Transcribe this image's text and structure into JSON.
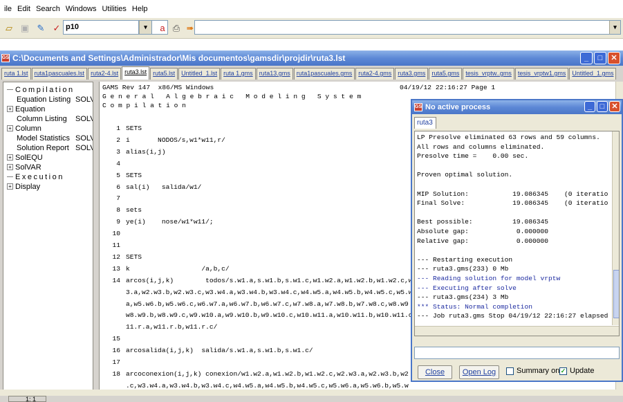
{
  "menubar": {
    "items": [
      "ile",
      "Edit",
      "Search",
      "Windows",
      "Utilities",
      "Help"
    ]
  },
  "toolbar": {
    "model_combo": "p10"
  },
  "window": {
    "title": "C:\\Documents and Settings\\Administrador\\Mis documentos\\gamsdir\\projdir\\ruta3.lst",
    "tabs": [
      "ruta 1.lst",
      "ruta1pascuales.lst",
      "ruta2-4.lst",
      "ruta3.lst",
      "ruta5.lst",
      "Untitled_1.lst",
      "ruta 1.gms",
      "ruta13.gms",
      "ruta1pascuales.gms",
      "ruta2-4.gms",
      "ruta3.gms",
      "ruta5.gms",
      "tesis_vrptw..gms",
      "tesis_vrptw1.gms",
      "Untitled_1.gms"
    ],
    "active_tab": 3
  },
  "tree": [
    {
      "label": "Compilation",
      "type": "line",
      "spaced": true
    },
    {
      "label": "Equation Listing",
      "col2": "SOLV",
      "type": "sub"
    },
    {
      "label": "Equation",
      "type": "expand"
    },
    {
      "label": "Column Listing",
      "col2": "SOLV",
      "type": "sub"
    },
    {
      "label": "Column",
      "type": "expand"
    },
    {
      "label": "Model Statistics",
      "col2": "SOLV",
      "type": "sub"
    },
    {
      "label": "Solution Report",
      "col2": "SOLV",
      "type": "sub"
    },
    {
      "label": "SolEQU",
      "type": "expand"
    },
    {
      "label": "SolVAR",
      "type": "expand"
    },
    {
      "label": "Execution",
      "type": "line",
      "spaced": true
    },
    {
      "label": "Display",
      "type": "expand"
    }
  ],
  "listing": {
    "header1": "GAMS Rev 147  x86/MS Windows",
    "header_date": "04/19/12 22:16:27 Page 1",
    "header2": "G e n e r a l   A l g e b r a i c   M o d e l i n g   S y s t e m",
    "header3": "C o m p i l a t i o n",
    "lines": [
      {
        "n": "1",
        "t": "SETS"
      },
      {
        "n": "2",
        "t": "i       NODOS/s,w1*w11,r/"
      },
      {
        "n": "3",
        "t": "alias(i,j)"
      },
      {
        "n": "4",
        "t": ""
      },
      {
        "n": "5",
        "t": "SETS"
      },
      {
        "n": "6",
        "t": "sal(i)   salida/w1/"
      },
      {
        "n": "7",
        "t": ""
      },
      {
        "n": "8",
        "t": "sets"
      },
      {
        "n": "9",
        "t": "ye(i)    nose/w1*w11/;"
      },
      {
        "n": "10",
        "t": ""
      },
      {
        "n": "11",
        "t": ""
      },
      {
        "n": "12",
        "t": "SETS"
      },
      {
        "n": "13",
        "t": "k                  /a,b,c/"
      },
      {
        "n": "14",
        "t": "arcos(i,j,k)        todos/s.w1.a,s.w1.b,s.w1.c,w1.w2.a,w1.w2.b,w1.w2.c,w2"
      },
      {
        "n": "",
        "t": "3.a,w2.w3.b,w2.w3.c,w3.w4.a,w3.w4.b,w3.w4.c,w4.w5.a,w4.w5.b,w4.w5.c,w5.w"
      },
      {
        "n": "",
        "t": "a,w5.w6.b,w5.w6.c,w6.w7.a,w6.w7.b,w6.w7.c,w7.w8.a,w7.w8.b,w7.w8.c,w8.w9"
      },
      {
        "n": "",
        "t": "w8.w9.b,w8.w9.c,w9.w10.a,w9.w10.b,w9.w10.c,w10.w11.a,w10.w11.b,w10.w11.c"
      },
      {
        "n": "",
        "t": "11.r.a,w11.r.b,w11.r.c/"
      },
      {
        "n": "15",
        "t": ""
      },
      {
        "n": "16",
        "t": "arcosalida(i,j,k)  salida/s.w1.a,s.w1.b,s.w1.c/"
      },
      {
        "n": "17",
        "t": ""
      },
      {
        "n": "18",
        "t": "arcoconexion(i,j,k) conexion/w1.w2.a,w1.w2.b,w1.w2.c,w2.w3.a,w2.w3.b,w2"
      },
      {
        "n": "",
        "t": ".c,w3.w4.a,w3.w4.b,w3.w4.c,w4.w5.a,w4.w5.b,w4.w5.c,w5.w6.a,w5.w6.b,w5.w"
      }
    ]
  },
  "process": {
    "title": "No active process",
    "tab": "ruta3",
    "log": [
      {
        "t": "LP Presolve eliminated 63 rows and 59 columns.",
        "c": "black"
      },
      {
        "t": "All rows and columns eliminated.",
        "c": "black"
      },
      {
        "t": "Presolve time =    0.00 sec.",
        "c": "black"
      },
      {
        "t": "",
        "c": "black"
      },
      {
        "t": "Proven optimal solution.",
        "c": "black"
      },
      {
        "t": "",
        "c": "black"
      },
      {
        "t": "MIP Solution:           19.086345    (0 iteratio",
        "c": "black"
      },
      {
        "t": "Final Solve:            19.086345    (0 iteratio",
        "c": "black"
      },
      {
        "t": "",
        "c": "black"
      },
      {
        "t": "Best possible:          19.086345",
        "c": "black"
      },
      {
        "t": "Absolute gap:            0.000000",
        "c": "black"
      },
      {
        "t": "Relative gap:            0.000000",
        "c": "black"
      },
      {
        "t": "",
        "c": "black"
      },
      {
        "t": "--- Restarting execution",
        "c": "black"
      },
      {
        "t": "--- ruta3.gms(233) 0 Mb",
        "c": "black"
      },
      {
        "t": "--- Reading solution for model vrptw",
        "c": "blue"
      },
      {
        "t": "--- Executing after solve",
        "c": "blue"
      },
      {
        "t": "--- ruta3.gms(234) 3 Mb",
        "c": "black"
      },
      {
        "t": "*** Status: Normal completion",
        "c": "blue"
      },
      {
        "t": "--- Job ruta3.gms Stop 04/19/12 22:16:27 elapsed",
        "c": "black"
      }
    ],
    "close_label": "Close",
    "open_log_label": "Open Log",
    "summary_label": "Summary only",
    "update_label": "Update"
  },
  "status": {
    "position": "1: 1"
  }
}
